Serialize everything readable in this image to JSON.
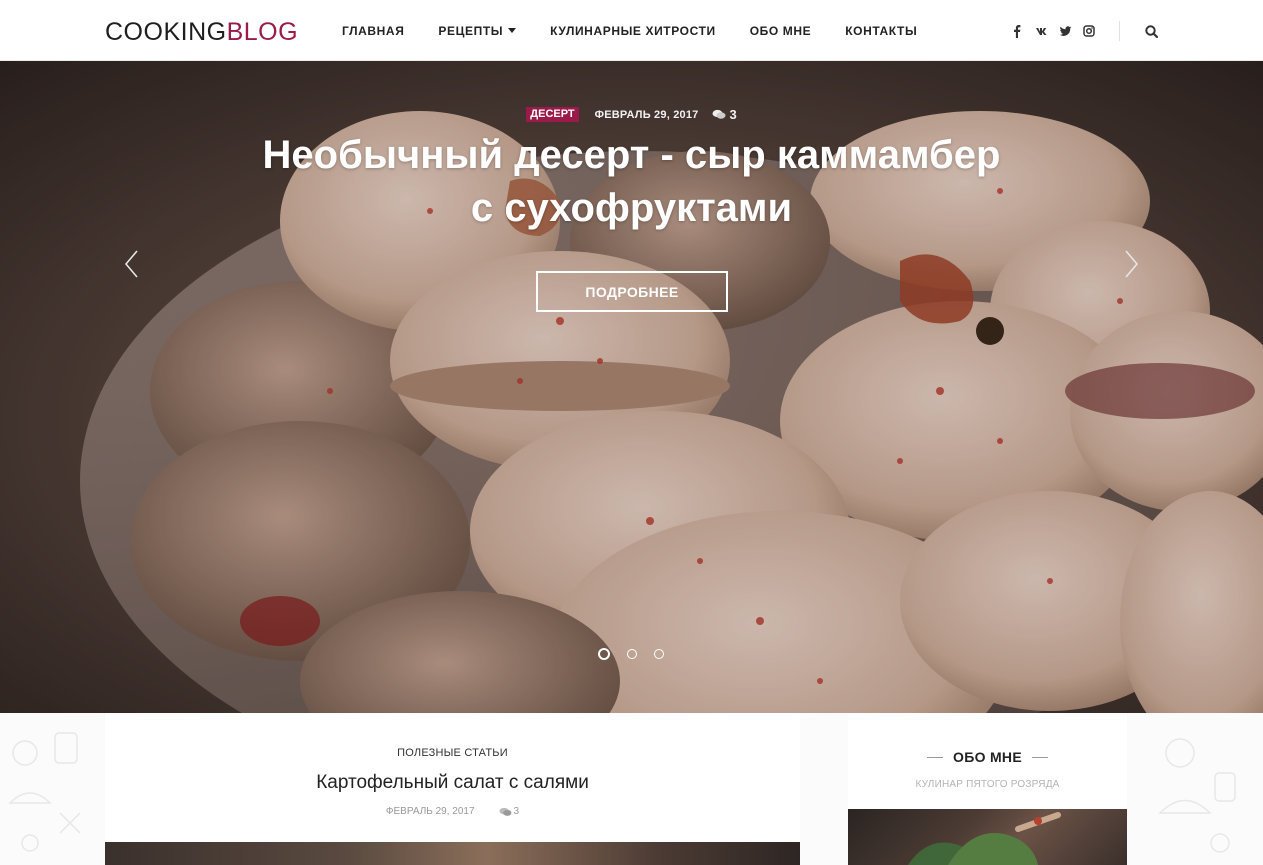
{
  "header": {
    "logo_part1": "COOKING",
    "logo_part2": "BLOG",
    "nav": [
      {
        "label": "ГЛАВНАЯ"
      },
      {
        "label": "РЕЦЕПТЫ",
        "has_dropdown": true
      },
      {
        "label": "КУЛИНАРНЫЕ ХИТРОСТИ"
      },
      {
        "label": "ОБО МНЕ"
      },
      {
        "label": "КОНТАКТЫ"
      }
    ],
    "social_icons": [
      "facebook-icon",
      "vk-icon",
      "twitter-icon",
      "instagram-icon"
    ],
    "search_icon": "search-icon"
  },
  "hero": {
    "category": "ДЕСЕРТ",
    "date": "ФЕВРАЛЬ 29, 2017",
    "comments": "3",
    "title_line1": "Необычный десерт - сыр каммамбер",
    "title_line2": "с сухофруктами",
    "button": "ПОДРОБНЕЕ",
    "slides_total": 3,
    "active_slide": 1
  },
  "article": {
    "category": "ПОЛЕЗНЫЕ СТАТЬИ",
    "title": "Картофельный салат с салями",
    "date": "ФЕВРАЛЬ 29, 2017",
    "comments": "3"
  },
  "sidebar": {
    "title": "ОБО МНЕ",
    "subtitle": "КУЛИНАР ПЯТОГО РОЗРЯДА"
  },
  "colors": {
    "accent": "#9a1b4a",
    "text": "#222222",
    "muted": "#999999"
  }
}
